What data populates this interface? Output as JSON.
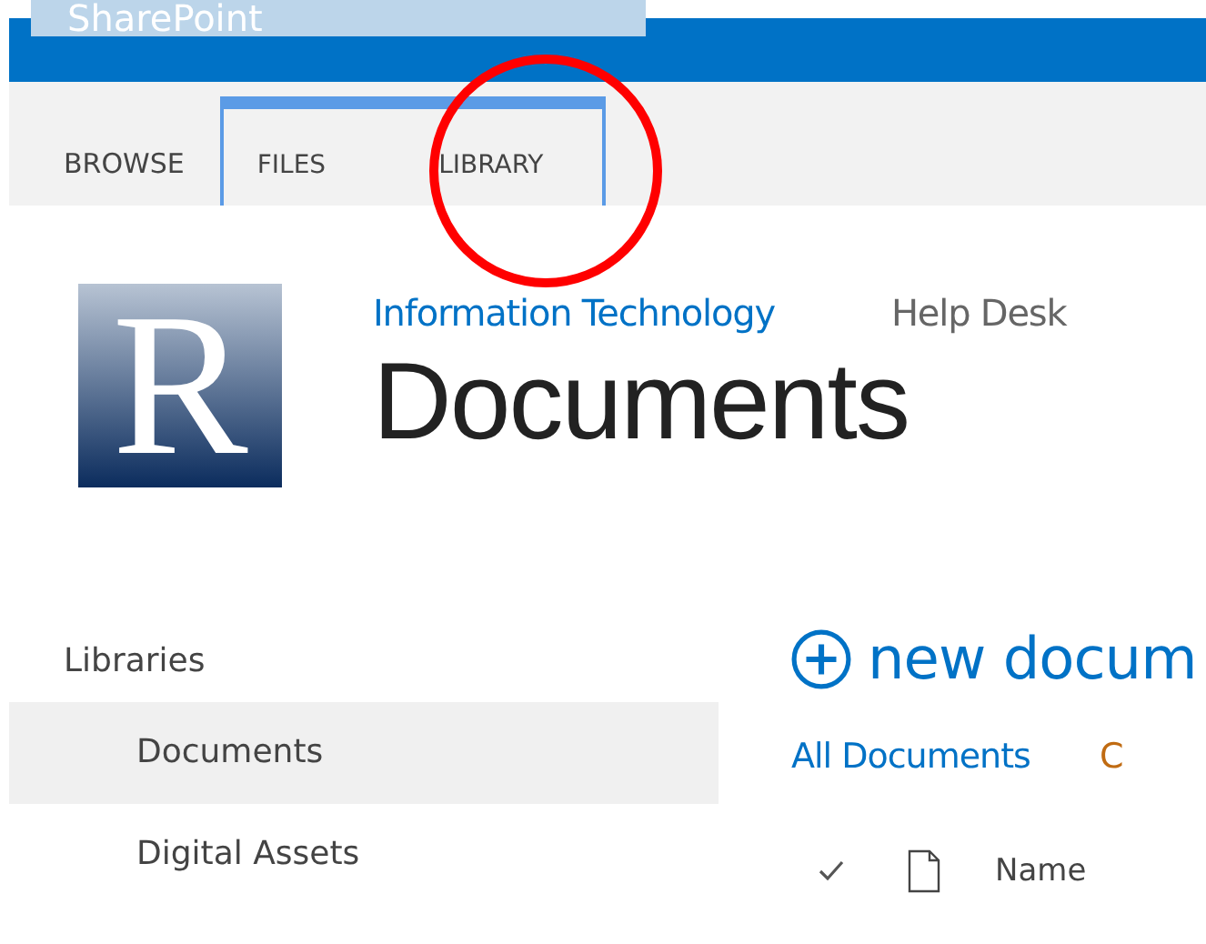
{
  "suite_bar": {
    "title": "SharePoint"
  },
  "ribbon_tabs": [
    {
      "label": "BROWSE",
      "selected": false,
      "contextual": false
    },
    {
      "label": "FILES",
      "selected": false,
      "contextual": true
    },
    {
      "label": "LIBRARY",
      "selected": false,
      "contextual": true
    }
  ],
  "annotation": {
    "kind": "circle",
    "color": "#ff0000"
  },
  "site": {
    "logo_letter": "R",
    "links": [
      {
        "label": "Information Technology",
        "selected": true
      },
      {
        "label": "Help Desk",
        "selected": false
      }
    ],
    "title": "Documents"
  },
  "quick_launch": {
    "heading": "Libraries",
    "items": [
      {
        "label": "Documents",
        "selected": true
      },
      {
        "label": "Digital Assets",
        "selected": false
      }
    ]
  },
  "library": {
    "new_label": "new docum",
    "views": [
      {
        "label": "All Documents",
        "selected": true
      },
      {
        "label": "C",
        "selected": false
      }
    ],
    "columns": [
      "Name"
    ]
  }
}
